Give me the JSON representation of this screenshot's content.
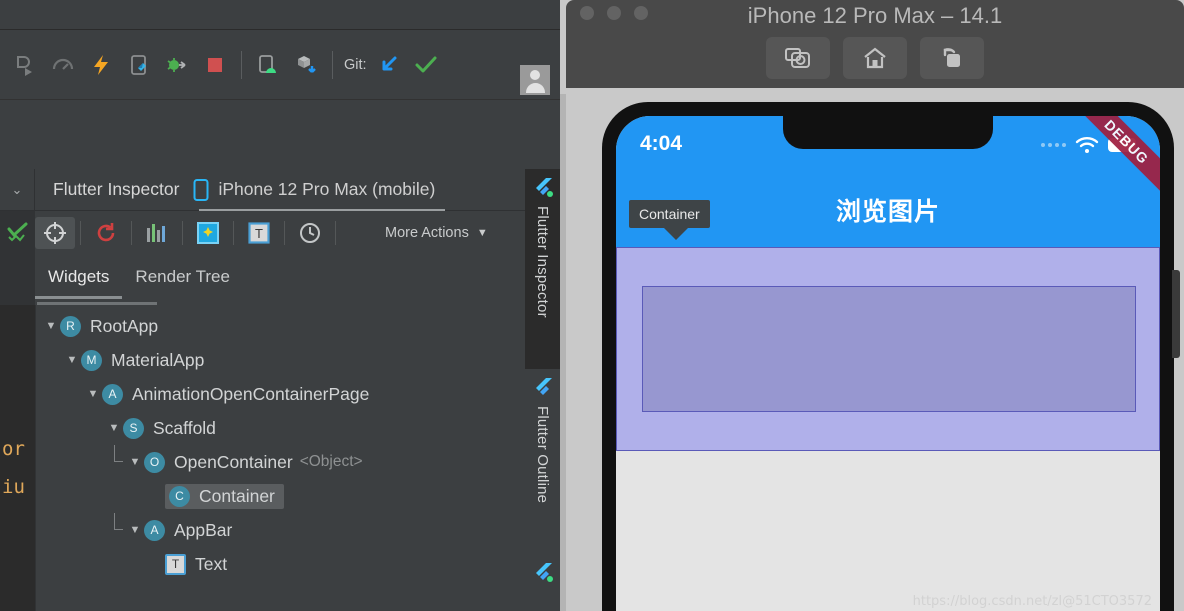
{
  "ide": {
    "toolbar": {
      "items": [
        {
          "name": "run-with-coverage-icon",
          "label": ""
        },
        {
          "name": "profile-icon",
          "label": ""
        },
        {
          "name": "hot-reload-icon",
          "label": ""
        },
        {
          "name": "flutter-device-icon",
          "label": ""
        },
        {
          "name": "debug-attach-icon",
          "label": ""
        },
        {
          "name": "stop-icon",
          "label": ""
        },
        {
          "name": "android-device-icon",
          "label": ""
        },
        {
          "name": "gradle-sync-icon",
          "label": ""
        }
      ],
      "git_label": "Git:",
      "git_update_icon": "update-project-icon",
      "git_commit_icon": "commit-checkmark-icon",
      "avatar": "user-avatar"
    },
    "panel": {
      "collapse_icon": "chevron-down-icon",
      "title": "Flutter Inspector",
      "device_icon": "mobile-device-icon",
      "device_label": "iPhone 12 Pro Max (mobile)"
    },
    "inspector_toolbar": {
      "inspection_icon": "inspections-checkmark-icon",
      "select_widget_mode": "target-crosshair-icon",
      "refresh_tree": "refresh-tree-icon",
      "performance_overlay": "performance-bars-icon",
      "debug_paint": "debug-paint-icon",
      "paint_baselines": "text-baseline-icon",
      "slow_animations": "clock-icon",
      "more_actions_label": "More Actions",
      "more_actions_chevron": "chevron-down-icon"
    },
    "tree_tabs": [
      {
        "label": "Widgets",
        "active": true
      },
      {
        "label": "Render Tree",
        "active": false
      }
    ],
    "tree_nodes": [
      {
        "indent": 0,
        "triangle": "▼",
        "badge": "R",
        "badge_type": "circle",
        "label": "RootApp",
        "generic": "",
        "selected": false,
        "elbow": false
      },
      {
        "indent": 1,
        "triangle": "▼",
        "badge": "M",
        "badge_type": "circle",
        "label": "MaterialApp",
        "generic": "",
        "selected": false,
        "elbow": false
      },
      {
        "indent": 2,
        "triangle": "▼",
        "badge": "A",
        "badge_type": "circle",
        "label": "AnimationOpenContainerPage",
        "generic": "",
        "selected": false,
        "elbow": false
      },
      {
        "indent": 3,
        "triangle": "▼",
        "badge": "S",
        "badge_type": "circle",
        "label": "Scaffold",
        "generic": "",
        "selected": false,
        "elbow": false
      },
      {
        "indent": 4,
        "triangle": "▼",
        "badge": "O",
        "badge_type": "circle",
        "label": "OpenContainer",
        "generic": "<Object>",
        "selected": false,
        "elbow": true
      },
      {
        "indent": 5,
        "triangle": "",
        "badge": "C",
        "badge_type": "circle",
        "label": "Container",
        "generic": "",
        "selected": true,
        "elbow": false
      },
      {
        "indent": 4,
        "triangle": "▼",
        "badge": "A",
        "badge_type": "circle",
        "label": "AppBar",
        "generic": "",
        "selected": false,
        "elbow": true
      },
      {
        "indent": 5,
        "triangle": "",
        "badge": "T",
        "badge_type": "square",
        "label": "Text",
        "generic": "",
        "selected": false,
        "elbow": false
      }
    ],
    "editor_gutter_code": [
      "or",
      "iu"
    ],
    "vertical_tabs": [
      {
        "label": "Flutter Inspector",
        "active": true,
        "icon": "flutter-logo-icon"
      },
      {
        "label": "Flutter Outline",
        "active": false,
        "icon": "flutter-logo-icon"
      },
      {
        "label": "",
        "active": false,
        "icon": "flutter-logo-icon"
      }
    ]
  },
  "simulator": {
    "window_title": "iPhone 12 Pro Max – 14.1",
    "traffic_lights": [
      "close-button",
      "minimize-button",
      "zoom-button"
    ],
    "actions": [
      {
        "name": "screenshot-button",
        "icon": "camera-icon"
      },
      {
        "name": "home-button",
        "icon": "home-icon"
      },
      {
        "name": "rotate-button",
        "icon": "rotate-icon"
      }
    ],
    "phone": {
      "status_bar": {
        "time": "4:04",
        "signal_icon": "signal-dots-icon",
        "wifi_icon": "wifi-icon",
        "battery_icon": "battery-icon"
      },
      "debug_banner": "DEBUG",
      "appbar_title": "浏览图片",
      "tooltip_label": "Container",
      "watermark": "https://blog.csdn.net/zl@51CTO3572"
    }
  },
  "colors": {
    "ide_bg": "#3c3f41",
    "panel_dark": "#2b2b2b",
    "accent_blue": "#2196f3",
    "badge_teal": "#3d8ba3",
    "highlight_outer": "#b0b0ea",
    "highlight_inner": "#9797d0",
    "debug_red": "#a02040",
    "selection": "#5a5d5f"
  }
}
